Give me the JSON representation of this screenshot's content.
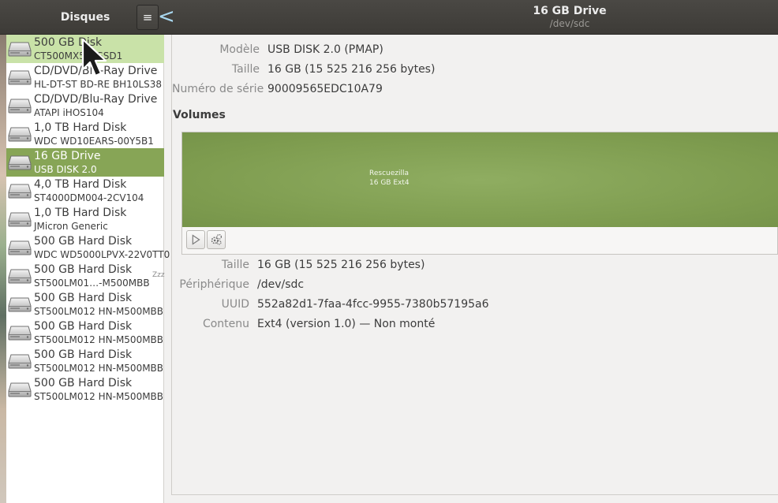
{
  "header": {
    "left_title": "Disques",
    "menu_icon": "≡",
    "back_icon": "<",
    "drive_title": "16 GB Drive",
    "drive_path": "/dev/sdc"
  },
  "sidebar": {
    "items": [
      {
        "name": "500 GB Disk",
        "detail": "CT500MX500SSD1",
        "state": "hover"
      },
      {
        "name": "CD/DVD/Blu-Ray Drive",
        "detail": "HL-DT-ST BD-RE  BH10LS38",
        "state": ""
      },
      {
        "name": "CD/DVD/Blu-Ray Drive",
        "detail": "ATAPI   iHOS104",
        "state": ""
      },
      {
        "name": "1,0 TB Hard Disk",
        "detail": "WDC WD10EARS-00Y5B1",
        "state": ""
      },
      {
        "name": "16 GB Drive",
        "detail": "USB DISK 2.0",
        "state": "selected"
      },
      {
        "name": "4,0 TB Hard Disk",
        "detail": "ST4000DM004-2CV104",
        "state": ""
      },
      {
        "name": "1,0 TB Hard Disk",
        "detail": "JMicron Generic",
        "state": ""
      },
      {
        "name": "500 GB Hard Disk",
        "detail": "WDC WD5000LPVX-22V0TT0",
        "state": ""
      },
      {
        "name": "500 GB Hard Disk",
        "detail": "ST500LM01…-M500MBB",
        "state": ""
      },
      {
        "name": "500 GB Hard Disk",
        "detail": "ST500LM012 HN-M500MBB",
        "state": ""
      },
      {
        "name": "500 GB Hard Disk",
        "detail": "ST500LM012 HN-M500MBB",
        "state": ""
      },
      {
        "name": "500 GB Hard Disk",
        "detail": "ST500LM012 HN-M500MBB",
        "state": ""
      },
      {
        "name": "500 GB Hard Disk",
        "detail": "ST500LM012 HN-M500MBB",
        "state": ""
      }
    ],
    "sleep_badge": "Zzz"
  },
  "drive": {
    "model_label": "Modèle",
    "model_value": "USB DISK 2.0 (PMAP)",
    "size_label": "Taille",
    "size_value": "16 GB (15 525 216 256 bytes)",
    "serial_label": "Numéro de série",
    "serial_value": "90009565EDC10A79"
  },
  "volumes": {
    "title": "Volumes",
    "partition_name": "Rescuezilla",
    "partition_desc": "16 GB Ext4"
  },
  "partition": {
    "size_label": "Taille",
    "size_value": "16 GB (15 525 216 256 bytes)",
    "device_label": "Périphérique",
    "device_value": "/dev/sdc",
    "uuid_label": "UUID",
    "uuid_value": "552a82d1-7faa-4fcc-9955-7380b57195a6",
    "content_label": "Contenu",
    "content_value": "Ext4 (version 1.0) — Non monté"
  },
  "colors": {
    "header_bg": "#3d3b37",
    "selected": "#87a556",
    "hover": "#c9e2a8",
    "volume_bar": "#7e9c4f"
  }
}
